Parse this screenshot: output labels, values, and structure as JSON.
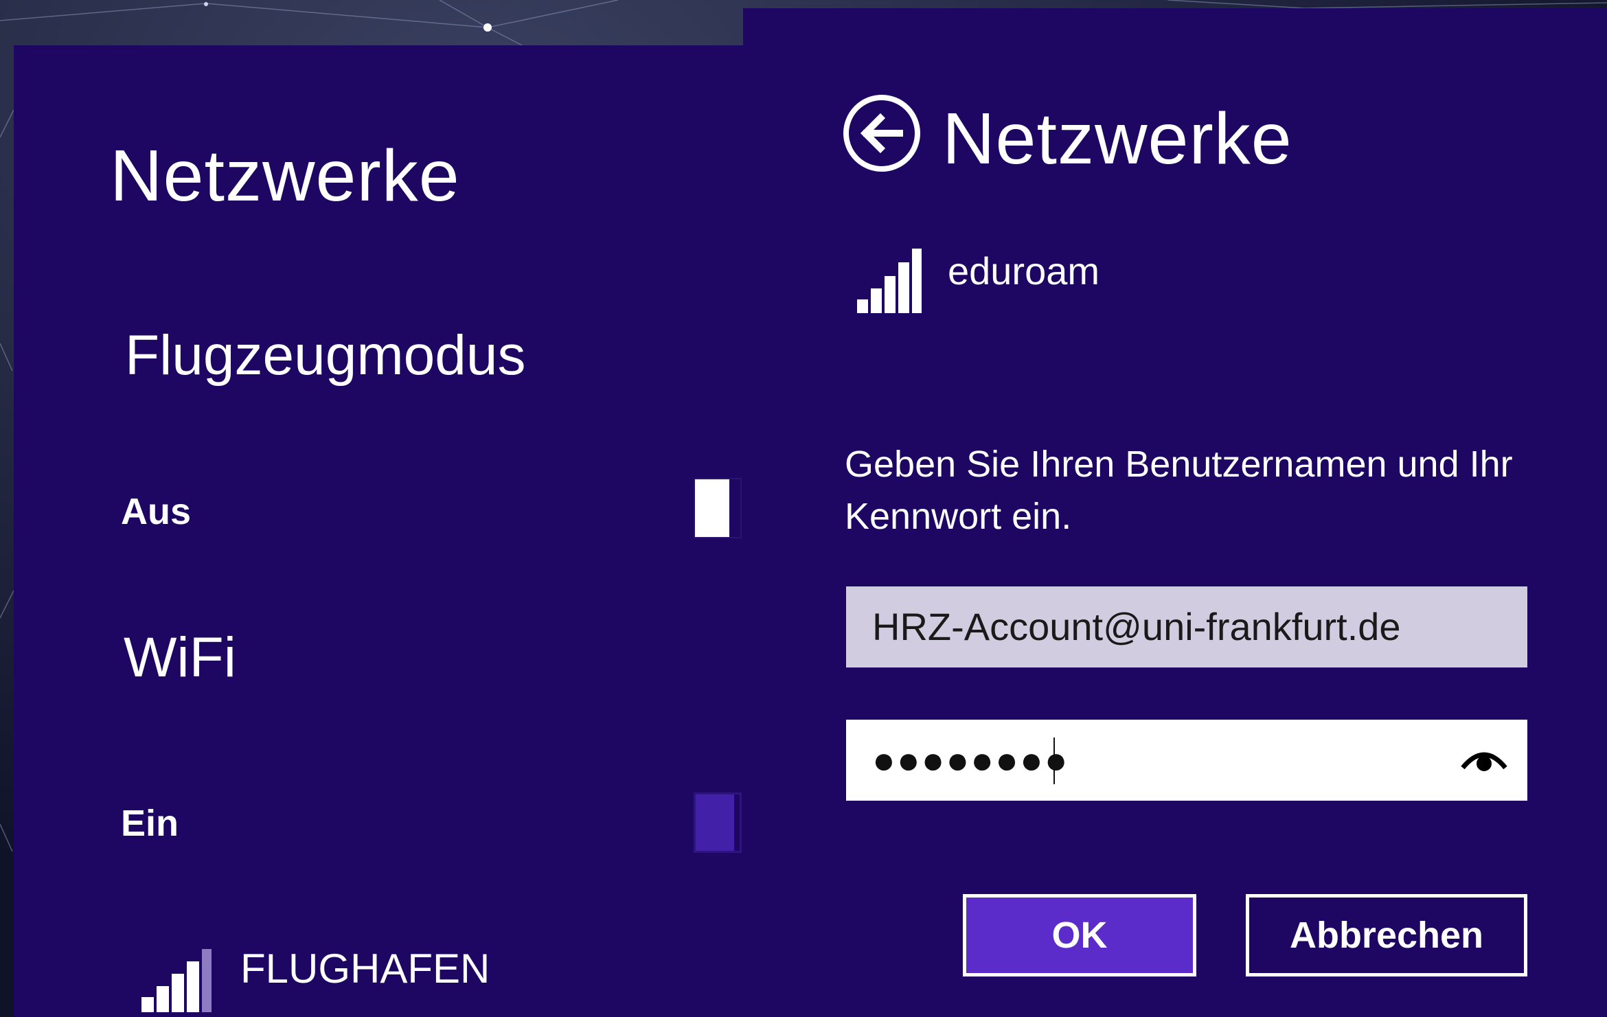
{
  "left_panel": {
    "title": "Netzwerke",
    "airplane_mode": {
      "heading": "Flugzeugmodus",
      "state_label": "Aus",
      "on": false
    },
    "wifi": {
      "heading": "WiFi",
      "state_label": "Ein",
      "on": true
    },
    "network": {
      "name": "FLUGHAFEN",
      "icon": "wifi-signal-icon"
    }
  },
  "right_panel": {
    "back_icon": "back-arrow-icon",
    "title": "Netzwerke",
    "network": {
      "name": "eduroam",
      "icon": "wifi-signal-icon"
    },
    "prompt": "Geben Sie Ihren Benutzernamen und Ihr Kennwort ein.",
    "username_value": "HRZ-Account@uni-frankfurt.de",
    "password_masked": "●●●●●●●●",
    "reveal_icon": "eye-icon",
    "ok_label": "OK",
    "cancel_label": "Abbrechen"
  },
  "colors": {
    "panel_background": "#1d0762",
    "accent": "#5c2ccb",
    "field_inactive": "#d1ccdf",
    "text": "#ffffff"
  }
}
